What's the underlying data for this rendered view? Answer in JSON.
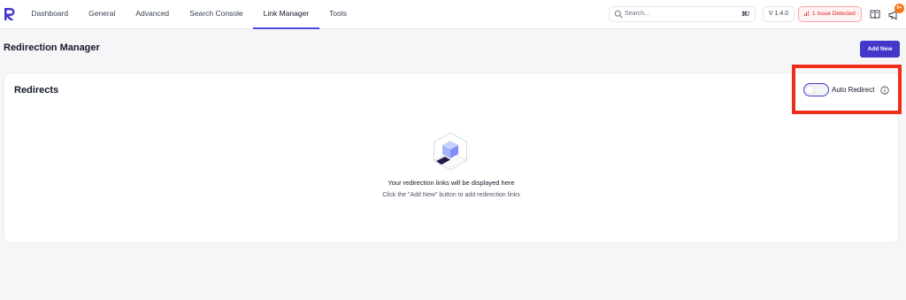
{
  "nav": {
    "items": [
      {
        "label": "Dashboard",
        "active": false
      },
      {
        "label": "General",
        "active": false
      },
      {
        "label": "Advanced",
        "active": false
      },
      {
        "label": "Search Console",
        "active": false
      },
      {
        "label": "Link Manager",
        "active": true
      },
      {
        "label": "Tools",
        "active": false
      }
    ]
  },
  "search": {
    "placeholder": "Search...",
    "shortcut": "⌘/"
  },
  "version": "V 1.4.0",
  "issue": {
    "label": "1 Issue Detected"
  },
  "notifications": {
    "badge": "9+"
  },
  "page": {
    "title": "Redirection Manager",
    "add_new_label": "Add New"
  },
  "card": {
    "title": "Redirects",
    "auto_redirect": {
      "label": "Auto Redirect",
      "enabled": false
    },
    "empty": {
      "title": "Your redirection links will be displayed here",
      "subtitle": "Click the \"Add New\" button to add redirection links"
    }
  },
  "colors": {
    "accent": "#4338ca",
    "issue_red": "#dc2626",
    "highlight": "#ef2d1b",
    "badge_orange": "#f97316"
  },
  "icons": [
    "logo-icon",
    "search-icon",
    "signal-icon",
    "book-icon",
    "megaphone-icon",
    "info-icon",
    "cube-illustration"
  ]
}
